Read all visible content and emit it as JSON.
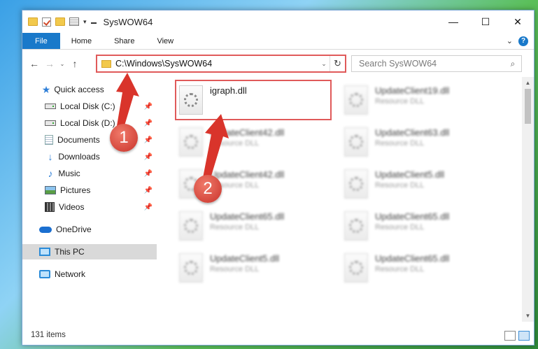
{
  "window": {
    "title": "SysWOW64",
    "controls": {
      "minimize": "—",
      "maximize": "☐",
      "close": "✕"
    }
  },
  "ribbon": {
    "tabs": [
      "File",
      "Home",
      "Share",
      "View"
    ],
    "expand_icon": "⌄",
    "help_icon": "?"
  },
  "nav": {
    "back": "←",
    "forward": "→",
    "recent": "⌄",
    "up": "↑",
    "address": "C:\\Windows\\SysWOW64",
    "refresh": "↻",
    "search_placeholder": "Search SysWOW64",
    "search_icon": "⌕"
  },
  "sidebar": {
    "items": [
      {
        "label": "Quick access",
        "icon": "star-icon"
      },
      {
        "label": "Local Disk (C:)",
        "icon": "disk-icon",
        "pinned": true
      },
      {
        "label": "Local Disk (D:)",
        "icon": "disk-icon",
        "pinned": true
      },
      {
        "label": "Documents",
        "icon": "documents-icon",
        "pinned": true
      },
      {
        "label": "Downloads",
        "icon": "download-icon",
        "pinned": true
      },
      {
        "label": "Music",
        "icon": "music-icon",
        "pinned": true
      },
      {
        "label": "Pictures",
        "icon": "pictures-icon",
        "pinned": true
      },
      {
        "label": "Videos",
        "icon": "videos-icon",
        "pinned": true
      },
      {
        "label": "OneDrive",
        "icon": "cloud-icon"
      },
      {
        "label": "This PC",
        "icon": "pc-icon",
        "selected": true
      },
      {
        "label": "Network",
        "icon": "network-icon"
      }
    ],
    "pin_glyph": "📌"
  },
  "files": [
    {
      "name": "igraph.dll",
      "type": ""
    },
    {
      "name": "UpdateClient19.dll",
      "type": "Resource DLL"
    },
    {
      "name": "UpdateClient42.dll",
      "type": "Resource DLL"
    },
    {
      "name": "UpdateClient63.dll",
      "type": "Resource DLL"
    },
    {
      "name": "UpdateClient42.dll",
      "type": "Resource DLL"
    },
    {
      "name": "UpdateClient5.dll",
      "type": "Resource DLL"
    },
    {
      "name": "UpdateClient65.dll",
      "type": "Resource DLL"
    },
    {
      "name": "UpdateClient65.dll",
      "type": "Resource DLL"
    },
    {
      "name": "UpdateClient5.dll",
      "type": "Resource DLL"
    },
    {
      "name": "UpdateClient65.dll",
      "type": "Resource DLL"
    }
  ],
  "status": {
    "item_count": "131 items"
  },
  "annotations": {
    "step1": "1",
    "step2": "2",
    "color": "#d9342b"
  }
}
